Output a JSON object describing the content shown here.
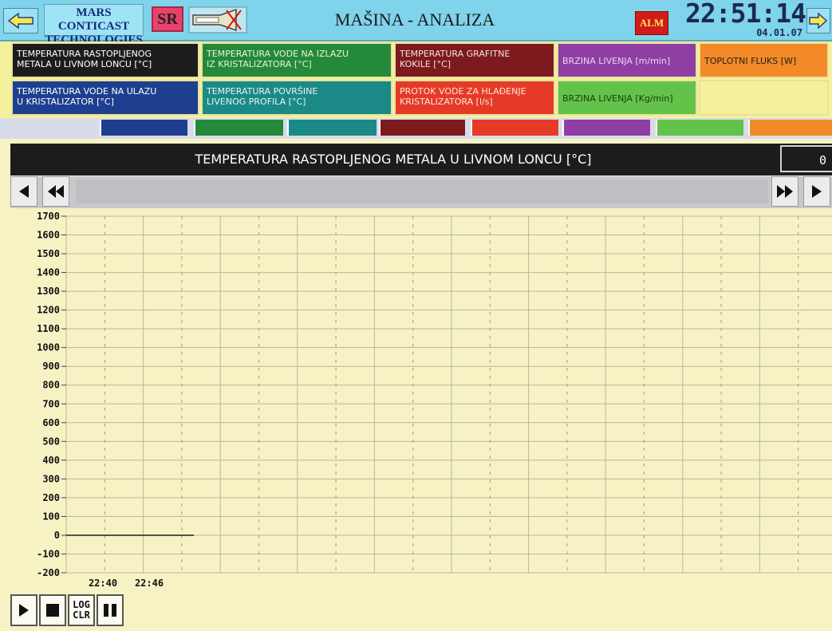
{
  "topbar": {
    "brand_line1": "MARS CONTICAST",
    "brand_line2": "TECHNOLOGIES",
    "lang": "SR",
    "title": "MAŠINA - ANALIZA",
    "alarm": "ALM",
    "time": "22:51:14",
    "date": "04.01.07"
  },
  "signals": [
    {
      "line1": "TEMPERATURA RASTOPLJENOG",
      "line2": "METALA U LIVNOM LONCU [°C]",
      "color": "#1c1c1c"
    },
    {
      "line1": "TEMPERATURA VODE NA IZLAZU",
      "line2": "IZ KRISTALIZATORA [°C]",
      "color": "#248a3a"
    },
    {
      "line1": "TEMPERATURA GRAFITNE",
      "line2": "KOKILE [°C]",
      "color": "#7c1a1e"
    },
    {
      "line1": "BRZINA LIVENJA [m/min]",
      "line2": "",
      "color": "#8f3fa3"
    },
    {
      "line1": "TOPLOTNI FLUKS [W]",
      "line2": "",
      "color": "#f28a27"
    },
    {
      "line1": "TEMPERATURA VODE NA ULAZU",
      "line2": "U KRISTALIZATOR [°C]",
      "color": "#1e3f8f"
    },
    {
      "line1": "TEMPERATURA POVRŠINE",
      "line2": "LIVENOG PROFILA [°C]",
      "color": "#1b8a86"
    },
    {
      "line1": "PROTOK VODE ZA HLAĐENJE",
      "line2": "KRISTALIZATORA [l/s]",
      "color": "#e63a28"
    },
    {
      "line1": "BRZINA LIVENJA [Kg/min]",
      "line2": "",
      "color": "#63c24a"
    }
  ],
  "color_strip": [
    "#1e3f8f",
    "#248a3a",
    "#1b8a86",
    "#7c1a1e",
    "#e63a28",
    "#8f3fa3",
    "#63c24a",
    "#f28a27"
  ],
  "chart_panel": {
    "title": "TEMPERATURA RASTOPLJENOG METALA U LIVNOM LONCU [°C]",
    "current_value": "0"
  },
  "controls": {
    "log_line1": "LOG",
    "log_line2": "CLR"
  },
  "chart_data": {
    "type": "line",
    "title": "TEMPERATURA RASTOPLJENOG METALA U LIVNOM LONCU [°C]",
    "ylim": [
      -200,
      1700
    ],
    "y_ticks": [
      1700,
      1600,
      1500,
      1400,
      1300,
      1200,
      1100,
      1000,
      900,
      800,
      700,
      600,
      500,
      400,
      300,
      200,
      100,
      0,
      -100,
      -200
    ],
    "x_tick_labels": [
      "22:40",
      "22:46"
    ],
    "grid": true,
    "series": [
      {
        "color": "#1c1c1c",
        "x": [
          "22:40",
          "22:46"
        ],
        "values": [
          0,
          0
        ]
      }
    ]
  }
}
